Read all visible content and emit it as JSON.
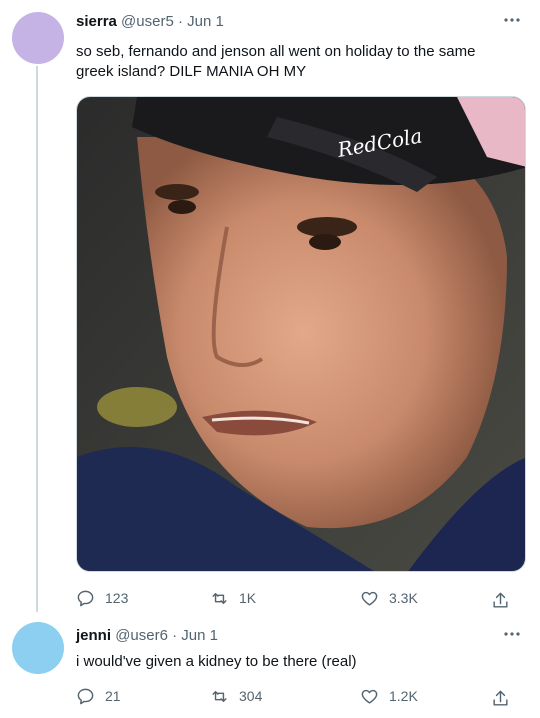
{
  "tweets": [
    {
      "display_name": "sierra",
      "handle": "@user5",
      "separator": "·",
      "date": "Jun 1",
      "text": "so seb, fernando and jenson all went on holiday to the same greek island? DILF MANIA OH MY",
      "avatar_color": "#c5b3e6",
      "media_caption": "RedCola",
      "stats": {
        "replies": "123",
        "retweets": "1K",
        "likes": "3.3K"
      }
    },
    {
      "display_name": "jenni",
      "handle": "@user6",
      "separator": "·",
      "date": "Jun 1",
      "text": "i would've given a kidney to be there (real)",
      "avatar_color": "#8ccff0",
      "stats": {
        "replies": "21",
        "retweets": "304",
        "likes": "1.2K"
      }
    }
  ],
  "icons": {
    "reply": "speech-bubble-icon",
    "retweet": "retweet-arrows-icon",
    "like": "heart-icon",
    "share": "share-upload-icon",
    "more": "more-dots-icon"
  },
  "colors": {
    "text_primary": "#0f1419",
    "text_secondary": "#536471",
    "thread_line": "#cfd9de"
  }
}
